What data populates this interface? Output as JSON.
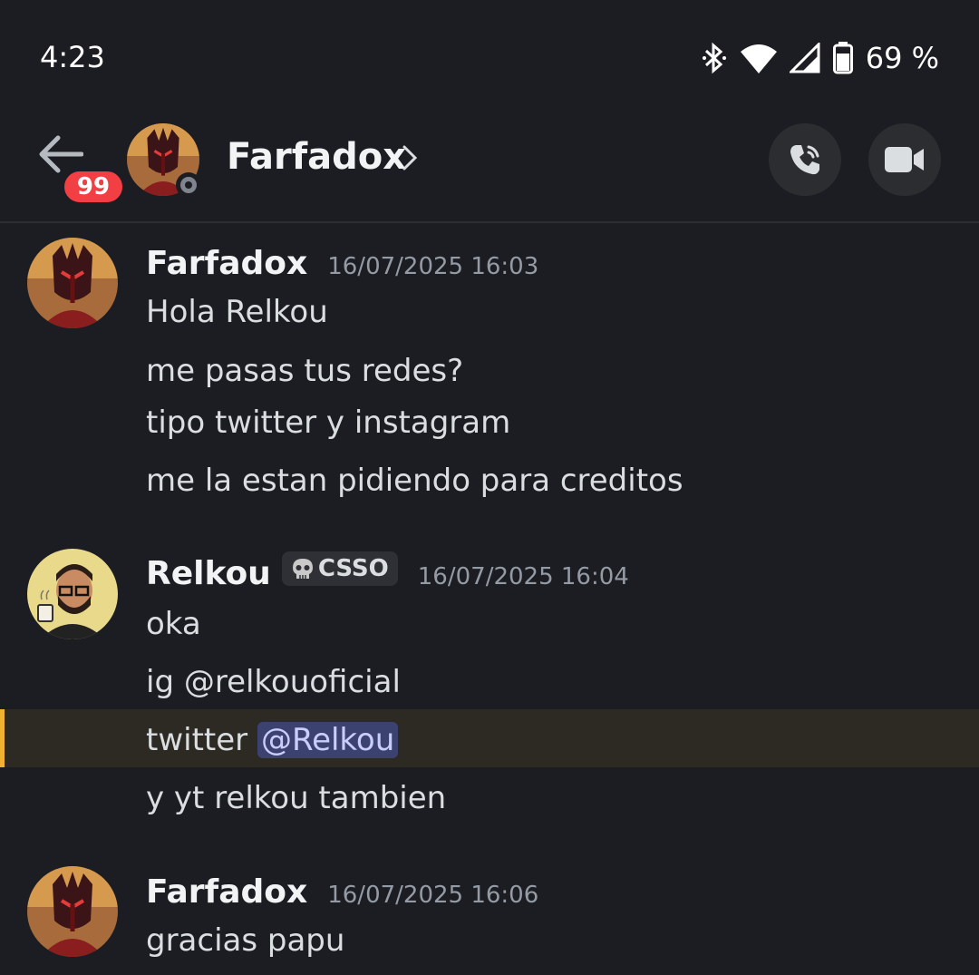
{
  "status_bar": {
    "time": "4:23",
    "battery": "69 %",
    "icons": [
      "bluetooth-icon",
      "wifi-icon",
      "signal-icon",
      "battery-icon"
    ]
  },
  "header": {
    "unread_badge": "99",
    "contact_name": "Farfadox",
    "presence": "offline"
  },
  "messages": [
    {
      "author": "Farfadox",
      "timestamp": "16/07/2025 16:03",
      "lines": [
        "Hola Relkou",
        "me pasas tus redes?",
        "tipo twitter y instagram",
        "me la estan pidiendo para creditos"
      ]
    },
    {
      "author": "Relkou",
      "tag": "CSSO",
      "timestamp": "16/07/2025 16:04",
      "lines": [
        "oka",
        "ig @relkouoficial",
        "twitter",
        "y yt relkou tambien"
      ],
      "mention": "@Relkou"
    },
    {
      "author": "Farfadox",
      "timestamp": "16/07/2025 16:06",
      "lines": [
        "gracias papu"
      ]
    }
  ],
  "colors": {
    "background": "#1c1d22",
    "badge": "#f23f43",
    "mention_bg": "#3c4270",
    "highlight_bar": "#f0b232"
  }
}
